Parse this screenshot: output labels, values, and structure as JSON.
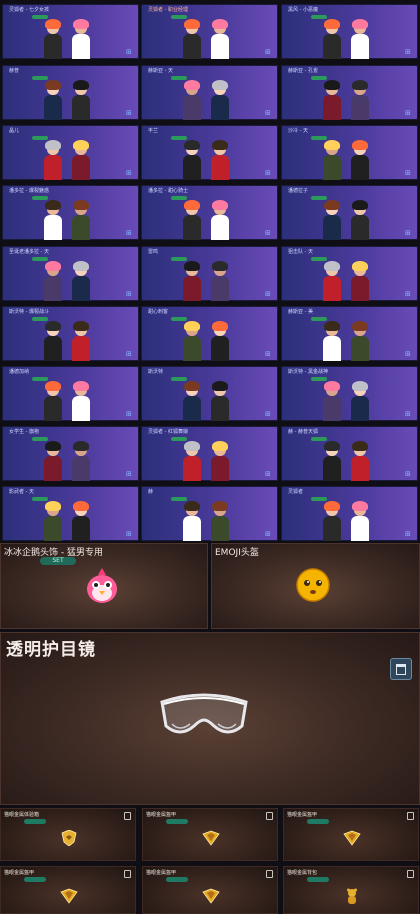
{
  "grid": {
    "cards": [
      {
        "name": "灵狐者 - 七夕女孩",
        "s": 0
      },
      {
        "name": "灵狐者 - 职业经理",
        "s": 0
      },
      {
        "name": "黑风 - 小恶魔",
        "s": 0
      },
      {
        "name": "赫普",
        "s": 1
      },
      {
        "name": "赫斯亚 - 天",
        "s": 2
      },
      {
        "name": "赫斯亚 - 孔雀",
        "s": 3
      },
      {
        "name": "晶儿",
        "s": 4
      },
      {
        "name": "丰兰",
        "s": 5
      },
      {
        "name": "沙冷 - 天",
        "s": 6
      },
      {
        "name": "潘多拉 - 爆裂魅惑",
        "s": 7
      },
      {
        "name": "潘多拉 - 甜心骑士",
        "s": 8
      },
      {
        "name": "潘德拉子",
        "s": 9
      },
      {
        "name": "圣诞老潘多拉 - 天",
        "s": 10
      },
      {
        "name": "雷鸣",
        "s": 11
      },
      {
        "name": "狙击队 - 天",
        "s": 12
      },
      {
        "name": "斯沃特 - 爆裂战斗",
        "s": 13
      },
      {
        "name": "甜心刺客",
        "s": 14
      },
      {
        "name": "赫斯亚 - 美",
        "s": 15
      },
      {
        "name": "潘德加纳",
        "s": 16
      },
      {
        "name": "斯沃特",
        "s": 17
      },
      {
        "name": "斯沃特 - 黑金战神",
        "s": 18
      },
      {
        "name": "女学生 - 旗袍",
        "s": 19
      },
      {
        "name": "灵狐者 - 红狐舞娘",
        "s": 20
      },
      {
        "name": "赫 - 赫普天狐",
        "s": 21
      },
      {
        "name": "影武者 - 天",
        "s": 22
      },
      {
        "name": "赫",
        "s": 23
      },
      {
        "name": "灵狐者",
        "s": 24
      }
    ],
    "highlight_index": 1
  },
  "penguin": {
    "title": "冰冰企鹅头饰 - 猛男专用",
    "set": "SET"
  },
  "emoji": {
    "title": "EMOJI头盔"
  },
  "goggles": {
    "title": "透明护目镜"
  },
  "badges": [
    {
      "title": "猫眼金属体验箱"
    },
    {
      "title": "猫眼金属盔甲"
    },
    {
      "title": "猫眼金属盔甲"
    },
    {
      "title": "猫眼金属盔甲"
    },
    {
      "title": "猫眼金属盔甲"
    },
    {
      "title": "猫眼金属背包"
    }
  ],
  "colors": {
    "card": "#4a3a9a",
    "set_pill": "#2b9a5a",
    "panel": "#3a2822"
  }
}
